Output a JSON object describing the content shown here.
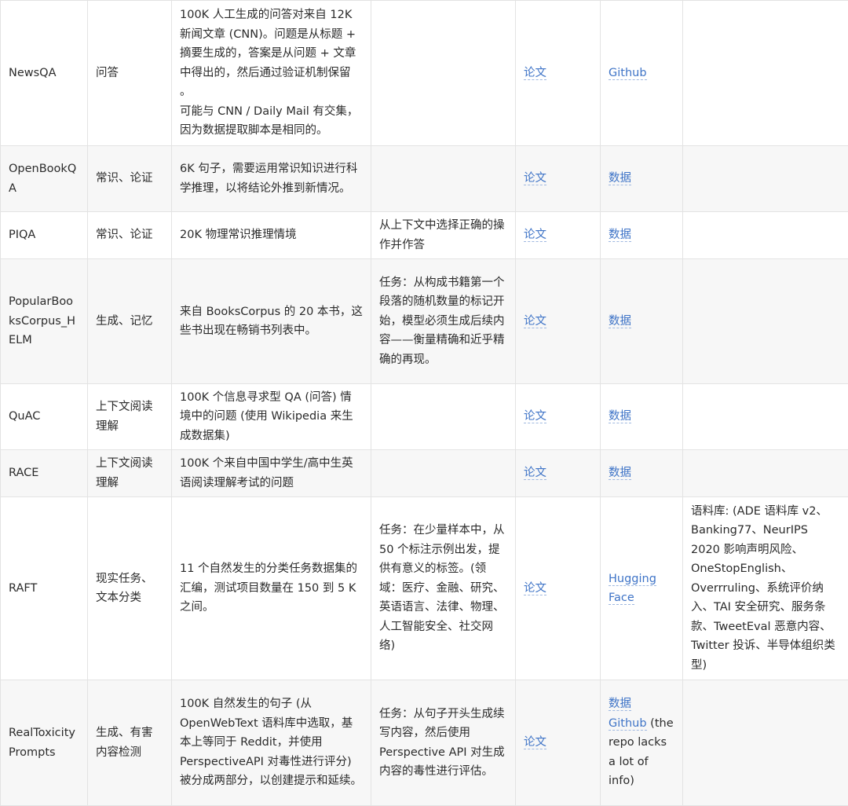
{
  "rows": [
    {
      "name": "NewsQA",
      "task": "问答",
      "desc": [
        "100K 人工生成的问答对来自 12K 新闻文章 (CNN)。问题是从标题 + 摘要生成的，答案是从问题 + 文章中得出的，然后通过验证机制保留 。",
        "可能与 CNN / Daily Mail 有交集，因为数据提取脚本是相同的。"
      ],
      "note": "",
      "paper": "论文",
      "data": [
        "Github"
      ],
      "data_note": "",
      "extra": ""
    },
    {
      "name": "OpenBookQA",
      "task": "常识、论证",
      "desc": [
        "6K 句子，需要运用常识知识进行科学推理，以将结论外推到新情况。"
      ],
      "note": "",
      "paper": "论文",
      "data": [
        "数据"
      ],
      "data_note": "",
      "extra": ""
    },
    {
      "name": "PIQA",
      "task": "常识、论证",
      "desc": [
        "20K 物理常识推理情境"
      ],
      "note": "从上下文中选择正确的操作并作答",
      "paper": "论文",
      "data": [
        "数据"
      ],
      "data_note": "",
      "extra": ""
    },
    {
      "name": "PopularBooksCorpus_HELM",
      "task": "生成、记忆",
      "desc": [
        "来自 BooksCorpus 的 20 本书，这些书出现在畅销书列表中。"
      ],
      "note": "任务：从构成书籍第一个段落的随机数量的标记开始，模型必须生成后续内容——衡量精确和近乎精确的再现。",
      "paper": "论文",
      "data": [
        "数据"
      ],
      "data_note": "",
      "extra": ""
    },
    {
      "name": "QuAC",
      "task": "上下文阅读理解",
      "desc": [
        "100K 个信息寻求型 QA (问答) 情境中的问题 (使用 Wikipedia 来生成数据集)"
      ],
      "note": "",
      "paper": "论文",
      "data": [
        "数据"
      ],
      "data_note": "",
      "extra": ""
    },
    {
      "name": "RACE",
      "task": "上下文阅读理解",
      "desc": [
        "100K 个来自中国中学生/高中生英语阅读理解考试的问题"
      ],
      "note": "",
      "paper": "论文",
      "data": [
        "数据"
      ],
      "data_note": "",
      "extra": ""
    },
    {
      "name": "RAFT",
      "task": "现实任务、文本分类",
      "desc": [
        "11 个自然发生的分类任务数据集的汇编，测试项目数量在 150 到 5 K 之间。"
      ],
      "note": "任务：在少量样本中，从 50 个标注示例出发，提供有意义的标签。(领域：医疗、金融、研究、英语语言、法律、物理、人工智能安全、社交网络)",
      "paper": "论文",
      "data": [
        "Hugging Face"
      ],
      "data_note": "",
      "extra": "语料库: (ADE 语料库 v2、Banking77、NeurIPS 2020 影响声明风险、OneStopEnglish、Overrruling、系统评价纳入、TAI 安全研究、服务条款、TweetEval 恶意内容、Twitter 投诉、半导体组织类型)"
    },
    {
      "name": "RealToxicityPrompts",
      "task": "生成、有害内容检测",
      "desc": [
        "100K 自然发生的句子 (从 OpenWebText 语料库中选取，基本上等同于 Reddit，并使用 PerspectiveAPI 对毒性进行评分) 被分成两部分，以创建提示和延续。"
      ],
      "note": "任务：从句子开头生成续写内容，然后使用 Perspective API 对生成内容的毒性进行评估。",
      "paper": "论文",
      "data": [
        "数据",
        "Github"
      ],
      "data_note": " (the repo lacks a lot of info)",
      "extra": ""
    }
  ]
}
